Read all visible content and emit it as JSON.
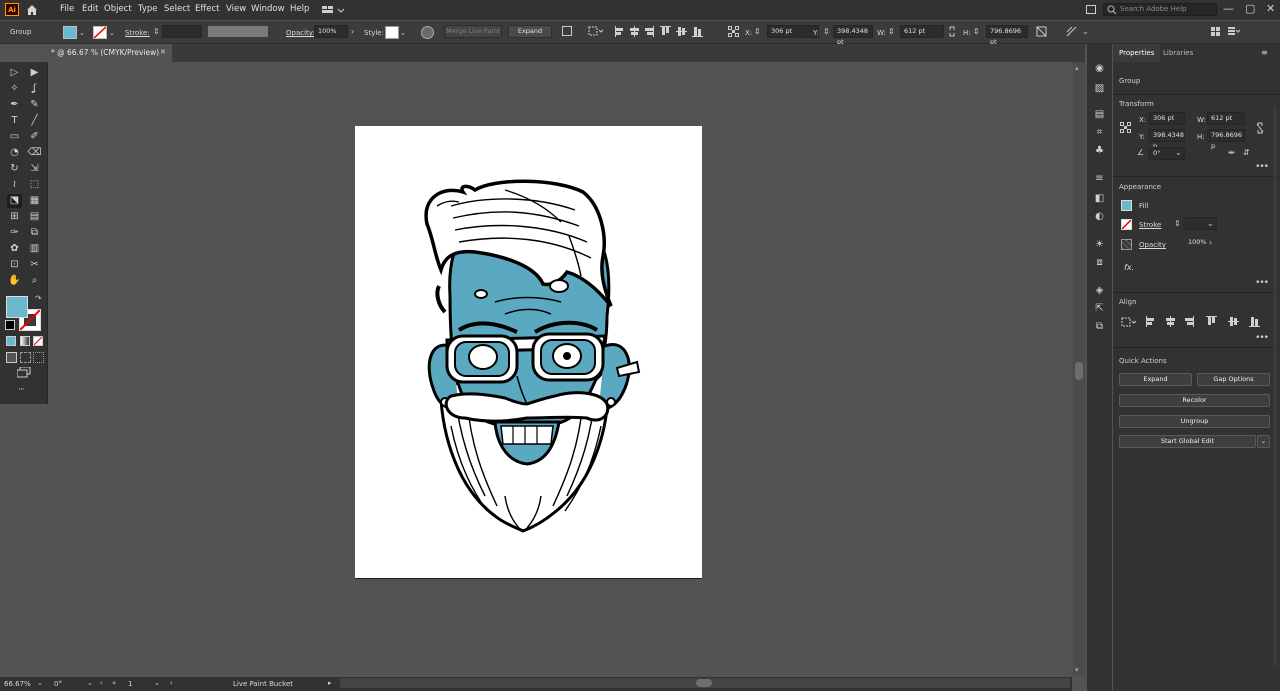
{
  "menubar": {
    "logo": "Ai",
    "items": [
      "File",
      "Edit",
      "Object",
      "Type",
      "Select",
      "Effect",
      "View",
      "Window",
      "Help"
    ],
    "search_placeholder": "Search Adobe Help",
    "window_controls": [
      "—",
      "▢",
      "✕"
    ]
  },
  "control_bar": {
    "selection": "Group",
    "stroke_label": "Stroke:",
    "opacity_label": "Opacity:",
    "opacity_value": "100%",
    "style_label": "Style:",
    "merge_live_paint": "Merge Live Paint",
    "expand": "Expand",
    "x_label": "X:",
    "x_value": "306 pt",
    "y_label": "Y:",
    "y_value": "398.4348 pt",
    "w_label": "W:",
    "w_value": "612 pt",
    "h_label": "H:",
    "h_value": "796.8696 pt"
  },
  "document_tab": {
    "title": "* @ 66.67 % (CMYK/Preview)",
    "close": "✕"
  },
  "colors": {
    "fill": "#6cb9cf",
    "accent": "#ff9a00",
    "artwork_blue": "#5aa9c0"
  },
  "tools": [
    "selection-tool",
    "direct-selection-tool",
    "magic-wand-tool",
    "lasso-tool",
    "pen-tool",
    "curvature-tool",
    "type-tool",
    "line-tool",
    "rectangle-tool",
    "paintbrush-tool",
    "shaper-tool",
    "eraser-tool",
    "rotate-tool",
    "scale-tool",
    "width-tool",
    "free-transform-tool",
    "live-paint-bucket-tool",
    "perspective-tool",
    "mesh-tool",
    "gradient-tool",
    "eyedropper-tool",
    "blend-tool",
    "symbol-sprayer-tool",
    "column-graph-tool",
    "artboard-tool",
    "slice-tool",
    "hand-tool",
    "zoom-tool"
  ],
  "panel": {
    "tabs": [
      "Properties",
      "Libraries"
    ],
    "selection": "Group",
    "transform": {
      "title": "Transform",
      "x_label": "X:",
      "x": "306 pt",
      "y_label": "Y:",
      "y": "398.4348 p",
      "w_label": "W:",
      "w": "612 pt",
      "h_label": "H:",
      "h": "796.8696 p",
      "angle": "0°"
    },
    "appearance": {
      "title": "Appearance",
      "fill": "Fill",
      "stroke": "Stroke",
      "opacity": "Opacity",
      "opacity_value": "100%",
      "fx": "fx."
    },
    "align": {
      "title": "Align"
    },
    "quick_actions": {
      "title": "Quick Actions",
      "expand": "Expand",
      "gap_options": "Gap Options",
      "recolor": "Recolor",
      "ungroup": "Ungroup",
      "start_global_edit": "Start Global Edit"
    }
  },
  "statusbar": {
    "zoom": "66.67%",
    "rotation": "0°",
    "artboard": "1",
    "tool": "Live Paint Bucket"
  }
}
